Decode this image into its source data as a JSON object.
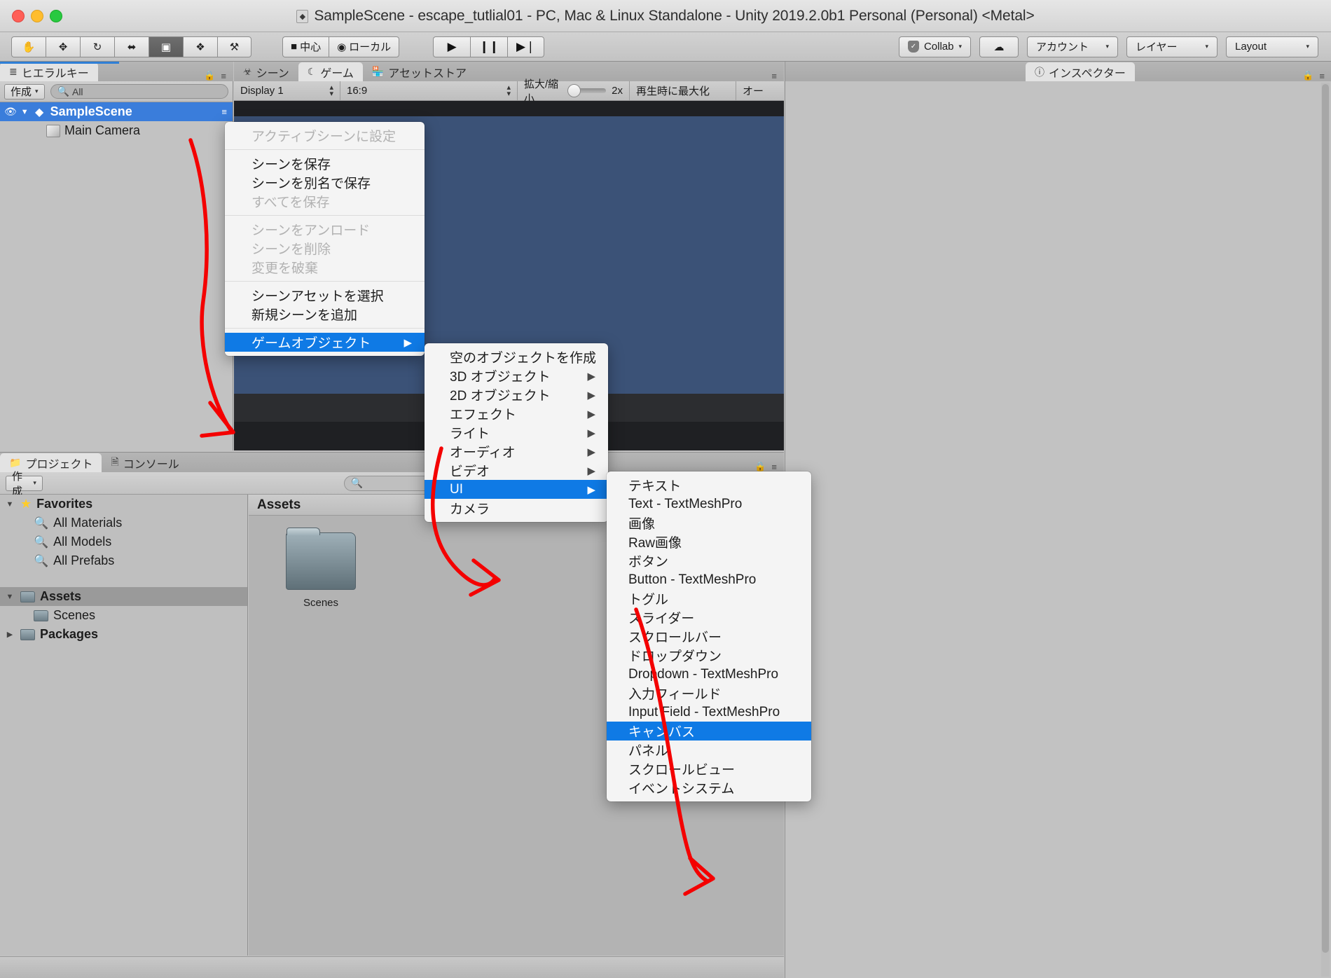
{
  "window": {
    "title": "SampleScene - escape_tutlial01 - PC, Mac & Linux Standalone - Unity 2019.2.0b1 Personal (Personal) <Metal>",
    "title_icon": "unity-icon"
  },
  "toolbar": {
    "tools": [
      {
        "name": "hand-tool",
        "glyph": "✋"
      },
      {
        "name": "move-tool",
        "glyph": "✥"
      },
      {
        "name": "rotate-tool",
        "glyph": "↻"
      },
      {
        "name": "scale-tool",
        "glyph": "⬌"
      },
      {
        "name": "rect-tool",
        "glyph": "▣"
      },
      {
        "name": "transform-tool",
        "glyph": "❖"
      },
      {
        "name": "custom-tool",
        "glyph": "⚒"
      }
    ],
    "pivot_label": "中心",
    "space_label": "ローカル",
    "play_label": "▶",
    "pause_label": "❙❙",
    "step_label": "▶❘",
    "collab_label": "Collab",
    "cloud_label": "☁",
    "account_label": "アカウント",
    "layers_label": "レイヤー",
    "layout_label": "Layout",
    "caret": "▾"
  },
  "hierarchy": {
    "tab_label": "ヒエラルキー",
    "tab_icon": "hierarchy-icon",
    "create_label": "作成",
    "search_placeholder": "All",
    "search_icon": "search-icon",
    "lock_icon": "lock-icon",
    "menu_icon": "panel-menu-icon",
    "items": [
      {
        "label": "SampleScene",
        "selected": true,
        "indent": 0,
        "icon": "unity-scene-icon"
      },
      {
        "label": "Main Camera",
        "selected": false,
        "indent": 1,
        "icon": "gameobject-cube-icon"
      }
    ]
  },
  "gameview": {
    "tabs": [
      {
        "label": "シーン",
        "icon": "scene-grid-icon",
        "active": false
      },
      {
        "label": "ゲーム",
        "icon": "game-pacman-icon",
        "active": true
      },
      {
        "label": "アセットストア",
        "icon": "assetstore-icon",
        "active": false
      }
    ],
    "lock_icon": "lock-icon",
    "menu_icon": "panel-menu-icon",
    "display_value": "Display 1",
    "aspect_value": "16:9",
    "scale_label": "拡大/縮小",
    "scale_value": "2x",
    "maximize_label": "再生時に最大化",
    "audio_label": "オー",
    "sky_color": "#3b5277",
    "ground_color": "#2c2d30"
  },
  "inspector": {
    "tab_label": "インスペクター",
    "tab_icon": "info-icon",
    "lock_icon": "lock-icon",
    "menu_icon": "panel-menu-icon"
  },
  "project": {
    "tabs": [
      {
        "label": "プロジェクト",
        "icon": "project-folder-icon",
        "active": true
      },
      {
        "label": "コンソール",
        "icon": "console-icon",
        "active": false
      }
    ],
    "create_label": "作成",
    "search_icon": "search-icon",
    "lock_icon": "lock-icon",
    "menu_icon": "panel-menu-icon",
    "tree": [
      {
        "label": "Favorites",
        "icon": "star-icon",
        "tri": "▼",
        "indent": 0,
        "bold": true,
        "selected": false
      },
      {
        "label": "All Materials",
        "icon": "magnifier-icon",
        "tri": "",
        "indent": 1,
        "bold": false,
        "selected": false
      },
      {
        "label": "All Models",
        "icon": "magnifier-icon",
        "tri": "",
        "indent": 1,
        "bold": false,
        "selected": false
      },
      {
        "label": "All Prefabs",
        "icon": "magnifier-icon",
        "tri": "",
        "indent": 1,
        "bold": false,
        "selected": false
      },
      {
        "label": "Assets",
        "icon": "folder-icon",
        "tri": "▼",
        "indent": 0,
        "bold": true,
        "selected": true
      },
      {
        "label": "Scenes",
        "icon": "folder-icon",
        "tri": "",
        "indent": 1,
        "bold": false,
        "selected": false
      },
      {
        "label": "Packages",
        "icon": "folder-icon",
        "tri": "▶",
        "indent": 0,
        "bold": true,
        "selected": false
      }
    ],
    "breadcrumb": "Assets",
    "assets": [
      {
        "label": "Scenes",
        "icon": "folder-icon"
      }
    ]
  },
  "menus": {
    "scene_context": {
      "name": "scene-context-menu",
      "items": [
        {
          "label": "アクティブシーンに設定",
          "state": "disabled",
          "submenu": false
        },
        {
          "sep": true
        },
        {
          "label": "シーンを保存",
          "state": "normal",
          "submenu": false
        },
        {
          "label": "シーンを別名で保存",
          "state": "normal",
          "submenu": false
        },
        {
          "label": "すべてを保存",
          "state": "disabled",
          "submenu": false
        },
        {
          "sep": true
        },
        {
          "label": "シーンをアンロード",
          "state": "disabled",
          "submenu": false
        },
        {
          "label": "シーンを削除",
          "state": "disabled",
          "submenu": false
        },
        {
          "label": "変更を破棄",
          "state": "disabled",
          "submenu": false
        },
        {
          "sep": true
        },
        {
          "label": "シーンアセットを選択",
          "state": "normal",
          "submenu": false
        },
        {
          "label": "新規シーンを追加",
          "state": "normal",
          "submenu": false
        },
        {
          "sep": true
        },
        {
          "label": "ゲームオブジェクト",
          "state": "highlighted",
          "submenu": true
        }
      ]
    },
    "gameobject_submenu": {
      "name": "gameobject-submenu",
      "items": [
        {
          "label": "空のオブジェクトを作成",
          "state": "normal",
          "submenu": false
        },
        {
          "label": "3D オブジェクト",
          "state": "normal",
          "submenu": true
        },
        {
          "label": "2D オブジェクト",
          "state": "normal",
          "submenu": true
        },
        {
          "label": "エフェクト",
          "state": "normal",
          "submenu": true
        },
        {
          "label": "ライト",
          "state": "normal",
          "submenu": true
        },
        {
          "label": "オーディオ",
          "state": "normal",
          "submenu": true
        },
        {
          "label": "ビデオ",
          "state": "normal",
          "submenu": true
        },
        {
          "label": "UI",
          "state": "highlighted",
          "submenu": true
        },
        {
          "label": "カメラ",
          "state": "normal",
          "submenu": false
        }
      ]
    },
    "ui_submenu": {
      "name": "ui-submenu",
      "items": [
        {
          "label": "テキスト",
          "state": "normal",
          "submenu": false
        },
        {
          "label": "Text - TextMeshPro",
          "state": "normal",
          "submenu": false
        },
        {
          "label": "画像",
          "state": "normal",
          "submenu": false
        },
        {
          "label": "Raw画像",
          "state": "normal",
          "submenu": false
        },
        {
          "label": "ボタン",
          "state": "normal",
          "submenu": false
        },
        {
          "label": "Button - TextMeshPro",
          "state": "normal",
          "submenu": false
        },
        {
          "label": "トグル",
          "state": "normal",
          "submenu": false
        },
        {
          "label": "スライダー",
          "state": "normal",
          "submenu": false
        },
        {
          "label": "スクロールバー",
          "state": "normal",
          "submenu": false
        },
        {
          "label": "ドロップダウン",
          "state": "normal",
          "submenu": false
        },
        {
          "label": "Dropdown - TextMeshPro",
          "state": "normal",
          "submenu": false
        },
        {
          "label": "入力フィールド",
          "state": "normal",
          "submenu": false
        },
        {
          "label": "Input Field - TextMeshPro",
          "state": "normal",
          "submenu": false
        },
        {
          "label": "キャンバス",
          "state": "highlighted",
          "submenu": false
        },
        {
          "label": "パネル",
          "state": "normal",
          "submenu": false
        },
        {
          "label": "スクロールビュー",
          "state": "normal",
          "submenu": false
        },
        {
          "label": "イベントシステム",
          "state": "normal",
          "submenu": false
        }
      ]
    },
    "submenu_arrow": "▶"
  },
  "annotations": {
    "color": "#f40000",
    "arrows": [
      {
        "name": "arrow-hierarchy-to-gameobject"
      },
      {
        "name": "arrow-gameobject-to-ui"
      },
      {
        "name": "arrow-ui-to-canvas"
      }
    ]
  },
  "colors": {
    "accent_blue": "#0f7ae5",
    "selection_blue": "#3a7ddb",
    "panel_gray": "#c2c2c2",
    "menu_bg": "#f4f4f4"
  }
}
